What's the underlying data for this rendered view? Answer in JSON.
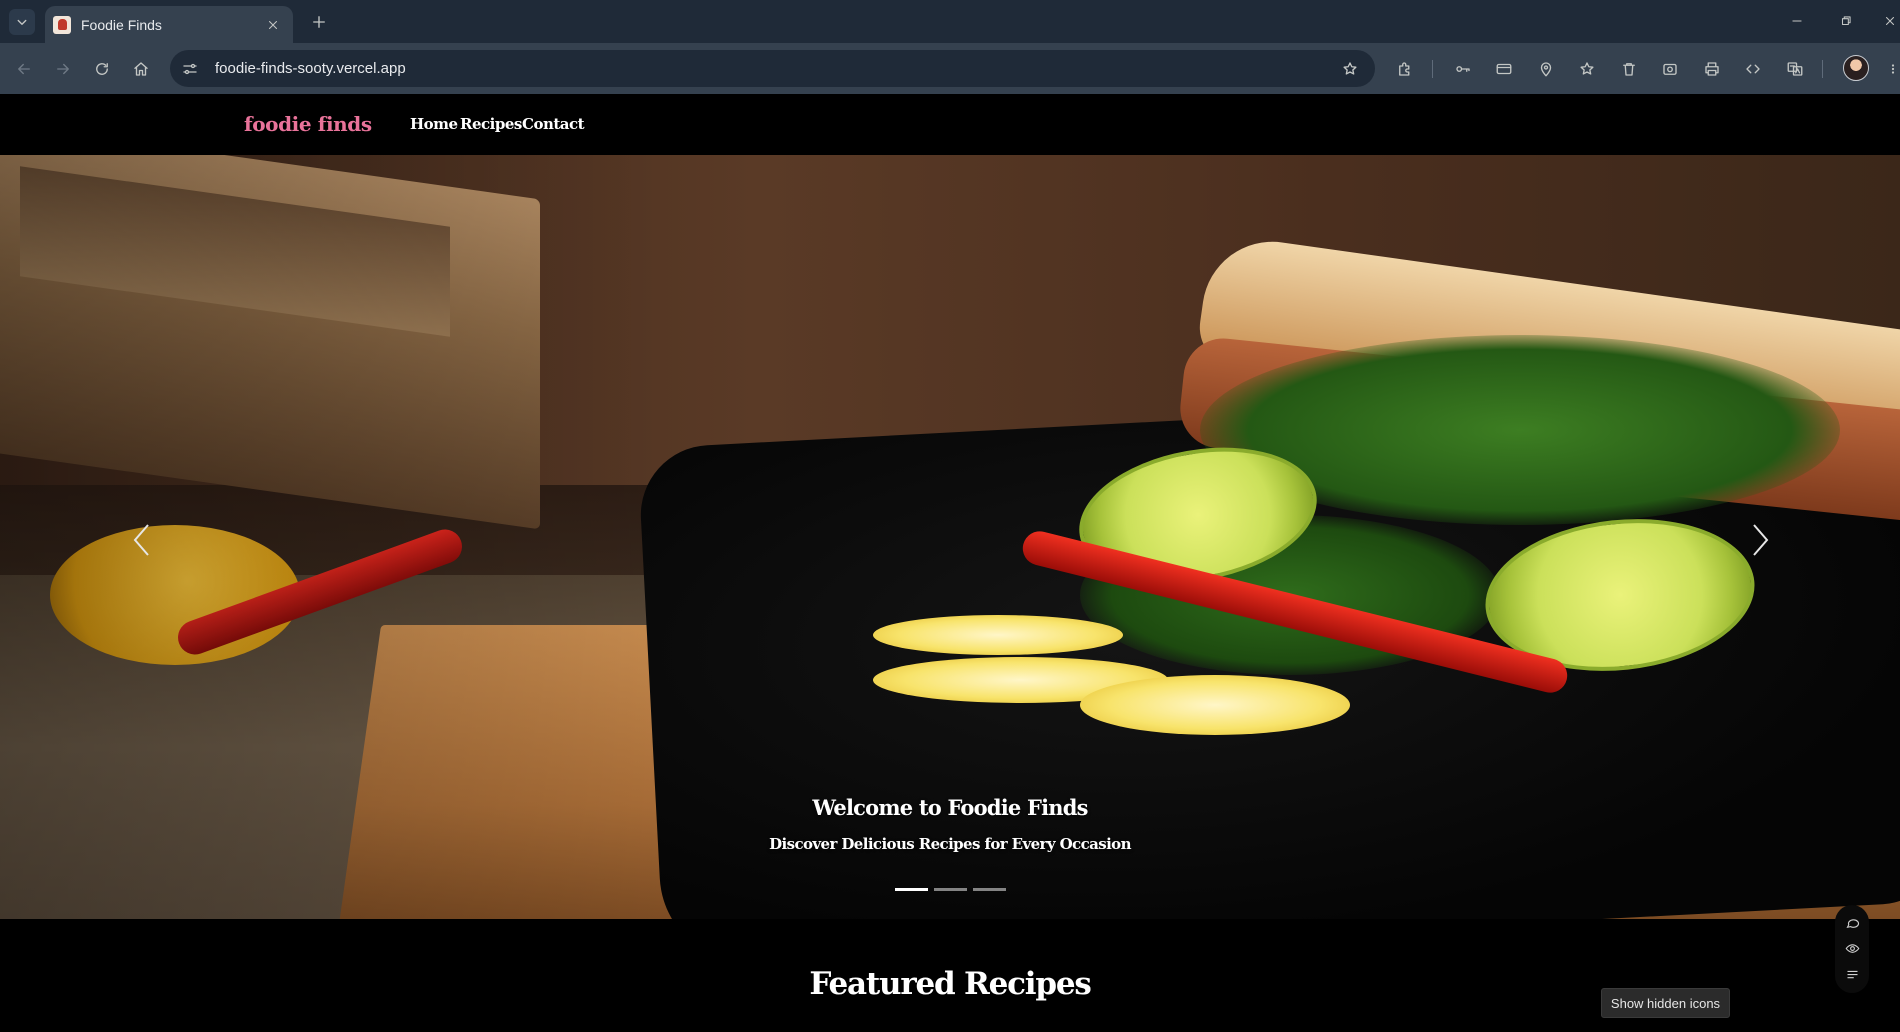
{
  "browser": {
    "tab": {
      "title": "Foodie Finds"
    },
    "address": {
      "url": "foodie-finds-sooty.vercel.app"
    },
    "icons": {
      "tab_list": "chevron-down-icon",
      "tab_close": "close-icon",
      "new_tab": "plus-icon",
      "back": "arrow-left-icon",
      "forward": "arrow-right-icon",
      "reload": "reload-icon",
      "home": "home-icon",
      "site_info": "tune-icon",
      "bookmark": "star-icon",
      "extensions": [
        "puzzle-icon",
        "key-icon",
        "card-icon",
        "location-pin-icon",
        "star-list-icon",
        "trash-icon",
        "screenshot-icon",
        "print-icon",
        "code-icon",
        "translate-icon"
      ],
      "menu": "kebab-menu-icon"
    }
  },
  "site": {
    "brand": "foodie finds",
    "nav": [
      {
        "label": "Home"
      },
      {
        "label": "Recipes"
      },
      {
        "label": "Contact"
      }
    ],
    "hero": {
      "title": "Welcome to Foodie Finds",
      "subtitle": "Discover Delicious Recipes for Every Occasion",
      "slide_count": 3,
      "active_slide": 1
    },
    "section_title": "Featured Recipes"
  },
  "overlay": {
    "tooltip": "Show hidden icons",
    "side_tools": [
      "chat-bubble-icon",
      "eye-icon",
      "list-icon"
    ]
  },
  "colors": {
    "brand": "#e9739a",
    "browser_tabbar": "#1f2a38",
    "browser_toolbar": "#35414f",
    "page_bg": "#000000"
  }
}
